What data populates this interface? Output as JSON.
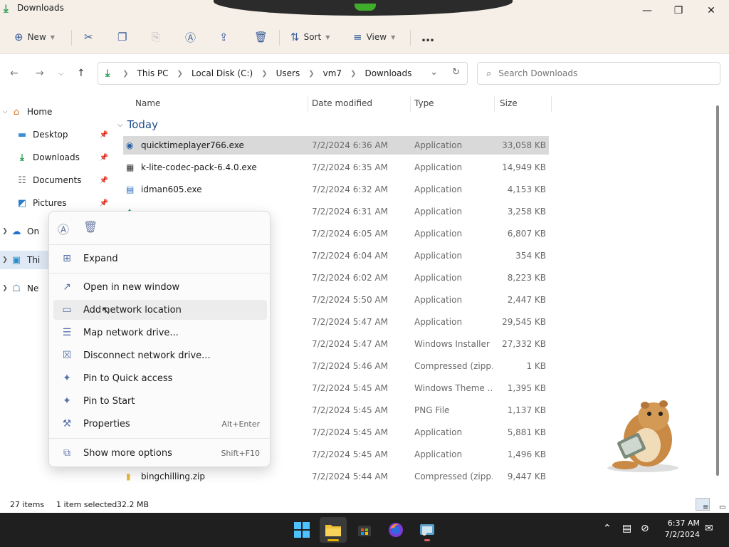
{
  "window": {
    "title": "Downloads"
  },
  "commandbar": {
    "new_label": "New",
    "sort_label": "Sort",
    "view_label": "View",
    "more_label": "…"
  },
  "address": {
    "segments": [
      "This PC",
      "Local Disk (C:)",
      "Users",
      "vm7",
      "Downloads"
    ]
  },
  "search": {
    "placeholder": "Search Downloads"
  },
  "sidebar": {
    "items": [
      {
        "label": "Home",
        "icon": "home-icon"
      },
      {
        "label": "Desktop",
        "icon": "desktop-icon"
      },
      {
        "label": "Downloads",
        "icon": "download-icon"
      },
      {
        "label": "Documents",
        "icon": "document-icon"
      },
      {
        "label": "Pictures",
        "icon": "pictures-icon"
      },
      {
        "label": "On",
        "icon": "cloud-icon"
      },
      {
        "label": "Thi",
        "icon": "computer-icon"
      },
      {
        "label": "Ne",
        "icon": "network-icon"
      }
    ]
  },
  "filelist": {
    "columns": [
      "Name",
      "Date modified",
      "Type",
      "Size"
    ],
    "group": "Today",
    "rows": [
      {
        "name": "quicktimeplayer766.exe",
        "date": "7/2/2024 6:36 AM",
        "type": "Application",
        "size": "33,058 KB"
      },
      {
        "name": "k-lite-codec-pack-6.4.0.exe",
        "date": "7/2/2024 6:35 AM",
        "type": "Application",
        "size": "14,949 KB"
      },
      {
        "name": "idman605.exe",
        "date": "7/2/2024 6:32 AM",
        "type": "Application",
        "size": "4,153 KB"
      },
      {
        "name": "",
        "date": "7/2/2024 6:31 AM",
        "type": "Application",
        "size": "3,258 KB"
      },
      {
        "name": "",
        "date": "7/2/2024 6:05 AM",
        "type": "Application",
        "size": "6,807 KB"
      },
      {
        "name": "",
        "date": "7/2/2024 6:04 AM",
        "type": "Application",
        "size": "354 KB"
      },
      {
        "name": "",
        "date": "7/2/2024 6:02 AM",
        "type": "Application",
        "size": "8,223 KB"
      },
      {
        "name": "",
        "date": "7/2/2024 5:50 AM",
        "type": "Application",
        "size": "2,447 KB"
      },
      {
        "name": "",
        "date": "7/2/2024 5:47 AM",
        "type": "Application",
        "size": "29,545 KB"
      },
      {
        "name": "",
        "date": "7/2/2024 5:47 AM",
        "type": "Windows Installer ...",
        "size": "27,332 KB"
      },
      {
        "name": "",
        "date": "7/2/2024 5:46 AM",
        "type": "Compressed (zipp...",
        "size": "1 KB"
      },
      {
        "name": "",
        "date": "7/2/2024 5:45 AM",
        "type": "Windows Theme ...",
        "size": "1,395 KB"
      },
      {
        "name": "",
        "date": "7/2/2024 5:45 AM",
        "type": "PNG File",
        "size": "1,137 KB"
      },
      {
        "name": "",
        "date": "7/2/2024 5:45 AM",
        "type": "Application",
        "size": "5,881 KB"
      },
      {
        "name": "",
        "date": "7/2/2024 5:45 AM",
        "type": "Application",
        "size": "1,496 KB"
      },
      {
        "name": "bingchilling.zip",
        "date": "7/2/2024 5:44 AM",
        "type": "Compressed (zipp...",
        "size": "9,447 KB"
      }
    ]
  },
  "context_menu": {
    "items": [
      {
        "label": "Expand",
        "shortcut": ""
      },
      {
        "label": "Open in new window",
        "shortcut": ""
      },
      {
        "label": "Add network location",
        "shortcut": ""
      },
      {
        "label": "Map network drive...",
        "shortcut": ""
      },
      {
        "label": "Disconnect network drive...",
        "shortcut": ""
      },
      {
        "label": "Pin to Quick access",
        "shortcut": ""
      },
      {
        "label": "Pin to Start",
        "shortcut": ""
      },
      {
        "label": "Properties",
        "shortcut": "Alt+Enter"
      },
      {
        "label": "Show more options",
        "shortcut": "Shift+F10"
      }
    ]
  },
  "status": {
    "item_count": "27 items",
    "selection": "1 item selected",
    "selection_size": "32.2 MB"
  },
  "taskbar": {
    "time": "6:37 AM",
    "date": "7/2/2024"
  },
  "colors": {
    "accent": "#1e9a4a",
    "titlebar_bg": "#f5efe8",
    "taskbar_bg": "#1f1f1f"
  }
}
